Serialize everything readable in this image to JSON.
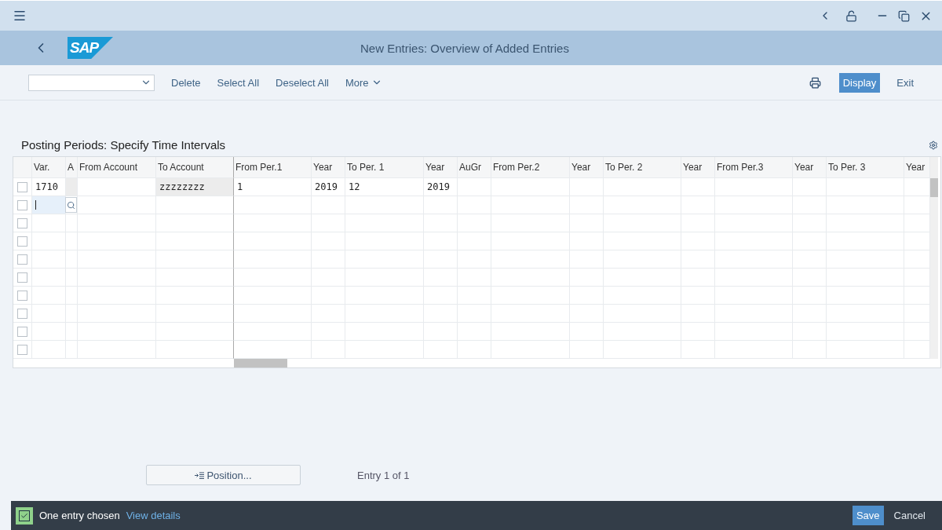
{
  "title_bar": {
    "logo": "SAP",
    "title": "New Entries: Overview of Added Entries"
  },
  "toolbar": {
    "actions": [
      {
        "label": "Delete",
        "kind": "link"
      },
      {
        "label": "Select All",
        "kind": "link"
      },
      {
        "label": "Deselect All",
        "kind": "link"
      },
      {
        "label": "More",
        "kind": "menu"
      }
    ],
    "right_actions": [
      {
        "label": "Display",
        "kind": "emphasized"
      },
      {
        "label": "Exit",
        "kind": "link"
      }
    ]
  },
  "table": {
    "title": "Posting Periods: Specify Time Intervals",
    "columns": [
      "Var.",
      "A",
      "From Account",
      "To Account",
      "From Per.1",
      "Year",
      "To Per. 1",
      "Year",
      "AuGr",
      "From Per.2",
      "Year",
      "To Per. 2",
      "Year",
      "From Per.3",
      "Year",
      "To Per. 3",
      "Year"
    ],
    "rows": [
      {
        "kind": "entry",
        "selected": false,
        "cells": [
          {
            "text": "1710",
            "readonly": false
          },
          {
            "readonly": true
          },
          {
            "readonly": false
          },
          {
            "text": "zzzzzzzz",
            "readonly": true
          },
          {
            "text": "1",
            "readonly": false
          },
          {
            "text": "2019",
            "readonly": false
          },
          {
            "text": "12",
            "readonly": false
          },
          {
            "text": "2019",
            "readonly": false
          }
        ]
      },
      {
        "kind": "input",
        "selected": false
      },
      {
        "kind": "blank",
        "selected": false
      },
      {
        "kind": "blank",
        "selected": false
      },
      {
        "kind": "blank",
        "selected": false
      },
      {
        "kind": "blank",
        "selected": false
      },
      {
        "kind": "blank",
        "selected": false
      },
      {
        "kind": "blank",
        "selected": false
      },
      {
        "kind": "blank",
        "selected": false
      },
      {
        "kind": "blank",
        "selected": false
      }
    ]
  },
  "position_button": {
    "label": "Position..."
  },
  "entry_info": "Entry 1 of 1",
  "footer": {
    "checked": true,
    "message": "One entry chosen",
    "link": "View details",
    "buttons": [
      {
        "label": "Save",
        "kind": "emphasized"
      },
      {
        "label": "Cancel",
        "kind": "link"
      }
    ]
  }
}
